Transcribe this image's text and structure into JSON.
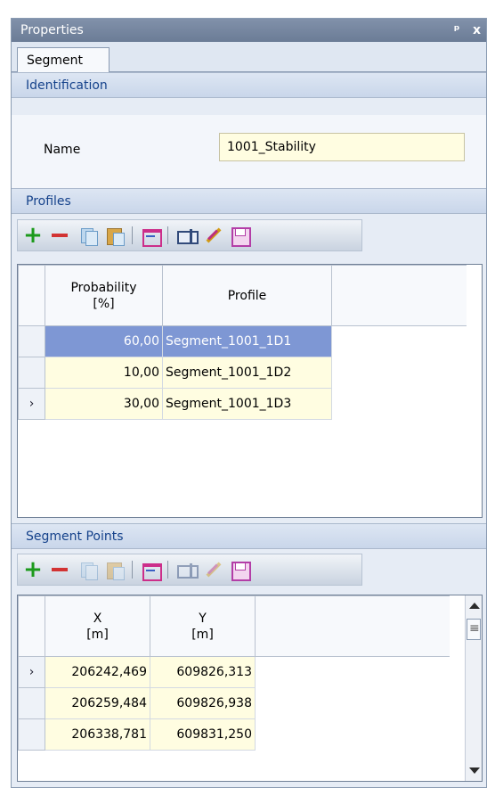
{
  "window": {
    "title": "Properties",
    "pin_glyph": "ᵖ",
    "close_glyph": "x"
  },
  "tab": {
    "label": "Segment"
  },
  "identification": {
    "header": "Identification",
    "name_label": "Name",
    "name_value": "1001_Stability"
  },
  "profiles": {
    "header": "Profiles",
    "columns": [
      "Probability\n[%]",
      "Profile"
    ],
    "rows": [
      {
        "probability": "60,00",
        "profile": "Segment_1001_1D1",
        "selected": true,
        "indicator": ""
      },
      {
        "probability": "10,00",
        "profile": "Segment_1001_1D2",
        "selected": false,
        "indicator": ""
      },
      {
        "probability": "30,00",
        "profile": "Segment_1001_1D3",
        "selected": false,
        "indicator": "›"
      }
    ]
  },
  "segment_points": {
    "header": "Segment Points",
    "columns": [
      "X\n[m]",
      "Y\n[m]"
    ],
    "rows": [
      {
        "x": "206242,469",
        "y": "609826,313",
        "indicator": "›"
      },
      {
        "x": "206259,484",
        "y": "609826,938",
        "indicator": ""
      },
      {
        "x": "206338,781",
        "y": "609831,250",
        "indicator": ""
      }
    ]
  },
  "icons": {
    "toolbar": [
      "add-icon",
      "remove-icon",
      "copy-icon",
      "paste-icon",
      "range-icon",
      "field-icon",
      "wand-icon",
      "save-icon"
    ]
  },
  "colors": {
    "title_bar": "#6b7c96",
    "selection": "#7e97d4",
    "editable_cell": "#fffde1",
    "add": "#1c9a1c",
    "remove": "#d23333"
  }
}
